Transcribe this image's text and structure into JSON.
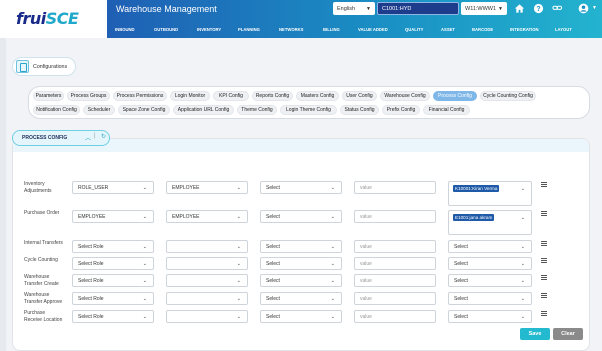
{
  "logo": {
    "part1": "frui",
    "part2": "SCE"
  },
  "header": {
    "title": "Warehouse Management",
    "language": "English",
    "location": "C1001:HYD",
    "warehouse": "W11:WWW1"
  },
  "nav": [
    "INBOUND",
    "OUTBOUND",
    "INVENTORY",
    "PLANNING",
    "NETWORKS",
    "BILLING",
    "VALUE ADDED",
    "QUALITY",
    "ASSET",
    "BARCODE",
    "INTEGRATION",
    "LAYOUT"
  ],
  "breadcrumb": "Configurations",
  "tabs_row1": [
    "Parameters",
    "Process Groups",
    "Process Permissions",
    "Login Monitor",
    "KPI Config",
    "Reports Config",
    "Masters Config",
    "User Config",
    "Warehouse Config",
    "Process Config",
    "Cycle Counting Config"
  ],
  "tabs_row2": [
    "Notification Config",
    "Scheduler",
    "Space Zone Config",
    "Application URL Config",
    "Theme Config",
    "Login Theme Config",
    "Status Config",
    "Prefix Config",
    "Financial Config"
  ],
  "active_tab": "Process Config",
  "section_title": "PROCESS CONFIG",
  "field_placeholders": {
    "role": "Select Role",
    "select": "Select",
    "value": "value"
  },
  "rows": [
    {
      "label": "Inventory Adjustments",
      "role": "ROLE_USER",
      "role2": "EMPLOYEE",
      "select": "Select",
      "value": "value",
      "chips": [
        "K10001:Kiran Verma",
        "x"
      ]
    },
    {
      "label": "Purchase Order",
      "role": "EMPLOYEE",
      "role2": "EMPLOYEE",
      "select": "Select",
      "value": "value",
      "chips": [
        "E1001:jana akram",
        "x"
      ]
    },
    {
      "label": "Internal Transfers",
      "role": "Select Role",
      "role2": "",
      "select": "Select",
      "value": "value",
      "last": "Select"
    },
    {
      "label": "Cycle Counting",
      "role": "Select Role",
      "role2": "",
      "select": "Select",
      "value": "value",
      "last": "Select"
    },
    {
      "label": "Warehouse Transfer Create",
      "role": "Select Role",
      "role2": "",
      "select": "Select",
      "value": "value",
      "last": "Select"
    },
    {
      "label": "Warehouse Transfer Approve",
      "role": "Select Role",
      "role2": "",
      "select": "Select",
      "value": "value",
      "last": "Select"
    },
    {
      "label": "Purchase Receive Location",
      "role": "Select Role",
      "role2": "",
      "select": "Select",
      "value": "value",
      "last": "Select"
    }
  ],
  "buttons": {
    "save": "Save",
    "clear": "Clear"
  },
  "colors": {
    "save": "#23b9cf",
    "clear": "#8a8a8a",
    "active_tab": "#7fb7e8",
    "chip": "#1f5aa8"
  }
}
